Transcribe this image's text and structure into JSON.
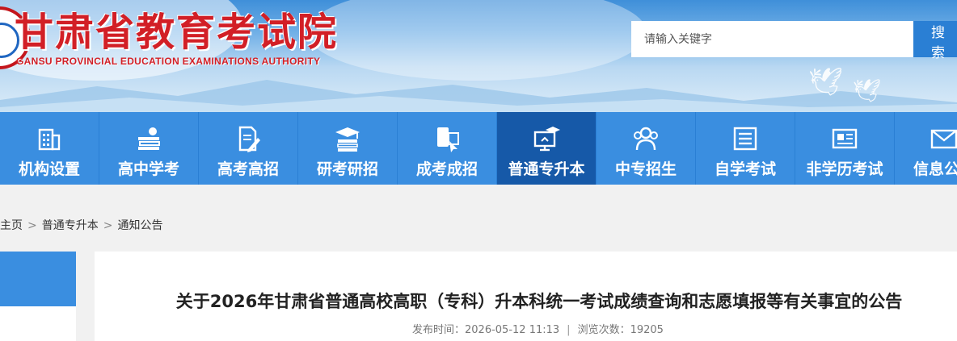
{
  "header": {
    "title_cn": "甘肃省教育考试院",
    "title_en": "GANSU PROVINCIAL EDUCATION EXAMINATIONS AUTHORITY",
    "search_placeholder": "请输入关键字",
    "search_label": "搜 索"
  },
  "nav": [
    {
      "label": "机构设置",
      "icon": "building-icon"
    },
    {
      "label": "高中学考",
      "icon": "books-apple-icon"
    },
    {
      "label": "高考高招",
      "icon": "document-pen-icon"
    },
    {
      "label": "研考研招",
      "icon": "graduation-books-icon"
    },
    {
      "label": "成考成招",
      "icon": "phone-cursor-icon"
    },
    {
      "label": "普通专升本",
      "icon": "monitor-cap-icon",
      "active": true
    },
    {
      "label": "中专招生",
      "icon": "group-icon"
    },
    {
      "label": "自学考试",
      "icon": "list-icon"
    },
    {
      "label": "非学历考试",
      "icon": "id-card-icon"
    },
    {
      "label": "信息公开",
      "icon": "mail-icon"
    }
  ],
  "breadcrumb": {
    "home": "主页",
    "section": "普通专升本",
    "current": "通知公告",
    "sep": ">"
  },
  "article": {
    "title": "关于2026年甘肃省普通高校高职（专科）升本科统一考试成绩查询和志愿填报等有关事宜的公告",
    "published_label": "发布时间：",
    "published": "2026-05-12 11:13",
    "divider": "|",
    "views_label": "浏览次数：",
    "views": "19205"
  },
  "colors": {
    "nav": "#3a8ee0",
    "nav_active": "#1659a8",
    "title_red": "#d21f26",
    "search_button": "#2a7fd4"
  }
}
